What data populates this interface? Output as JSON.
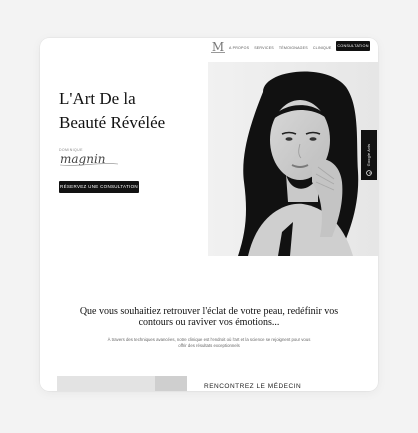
{
  "header": {
    "logo_letter": "M",
    "nav": [
      "A propos",
      "Services",
      "Témoignages",
      "Clinique"
    ],
    "cta": "Consultation"
  },
  "hero": {
    "title_line1": "L'Art De la",
    "title_line2": "Beauté Révélée",
    "signature_top": "DOMINIQUE",
    "signature": "magnin",
    "cta": "Réservez une Consultation"
  },
  "side_tab": {
    "label": "Google Avis",
    "icon": "google-icon"
  },
  "intro": {
    "heading": "Que vous souhaitiez retrouver l'éclat de votre peau, redéfinir vos contours ou raviver vos émotions...",
    "body": "À travers des techniques avancées, notre clinique est l'endroit où l'art et la science se rejoignent pour vous offrir des résultats exceptionnels"
  },
  "section2": {
    "heading": "Rencontrez le médecin"
  },
  "colors": {
    "accent": "#111111",
    "background": "#ffffff",
    "page": "#f3f3f3"
  }
}
